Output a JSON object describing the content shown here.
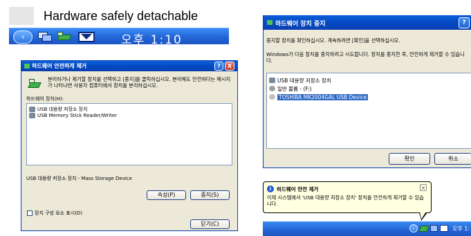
{
  "tray_top": {
    "tooltip": "Hardware safely detachable",
    "clock": "오후 1:10",
    "icons": [
      "back-arrow-icon",
      "network-icon",
      "hardware-icon",
      "tray-flag-icon"
    ]
  },
  "dialog_left": {
    "title": "하드웨어 안전하게 제거",
    "instruction": "분리하거나 제거할 장치를 선택하고 [중지]를 클릭하십시오. 분리해도 안전하다는 메시지가 나타나면 사용자 컴퓨터에서 장치를 분리하십시오.",
    "devices_label": "하드웨어 장치(H):",
    "devices": [
      "USB 대용량 저장소 장치",
      "USB Memory Stick Reader/Writer"
    ],
    "status": "USB 대용량 저장소 장치 - Mass Storage Device",
    "properties_button": "속성(P)",
    "stop_button": "중지(S)",
    "checkbox_label": "장치 구성 요소 표시(D)",
    "close_button": "닫기(C)",
    "help": "?",
    "close_x": "X"
  },
  "dialog_right": {
    "title": "하드웨어 장치 중지",
    "line1": "중지할 장치를 확인하십시오. 계속하려면 [확인]을 선택하십시오.",
    "line2": "Windows가 다음 장치를 중지하려고 시도합니다. 장치를 중지한 후, 안전하게 제거할 수 있습니다.",
    "devices": [
      "USB 대용량 저장소 장치",
      "일반 볼륨 - (F:)",
      "TOSHIBA MK2004GAL USB Device"
    ],
    "ok_button": "확인",
    "cancel_button": "취소",
    "help": "?"
  },
  "balloon": {
    "title": "하드웨어 안전 제거",
    "message": "이제 시스템에서 'USB 대용량 저장소 장치' 장치를 안전하게 제거할 수 있습니다.",
    "close": "×",
    "info_icon": "i",
    "clock": "오후 1:"
  },
  "colors": {
    "taskbar_blue": "#2c6fe0",
    "selection": "#316ac5",
    "dialog_face": "#ece9d8"
  }
}
